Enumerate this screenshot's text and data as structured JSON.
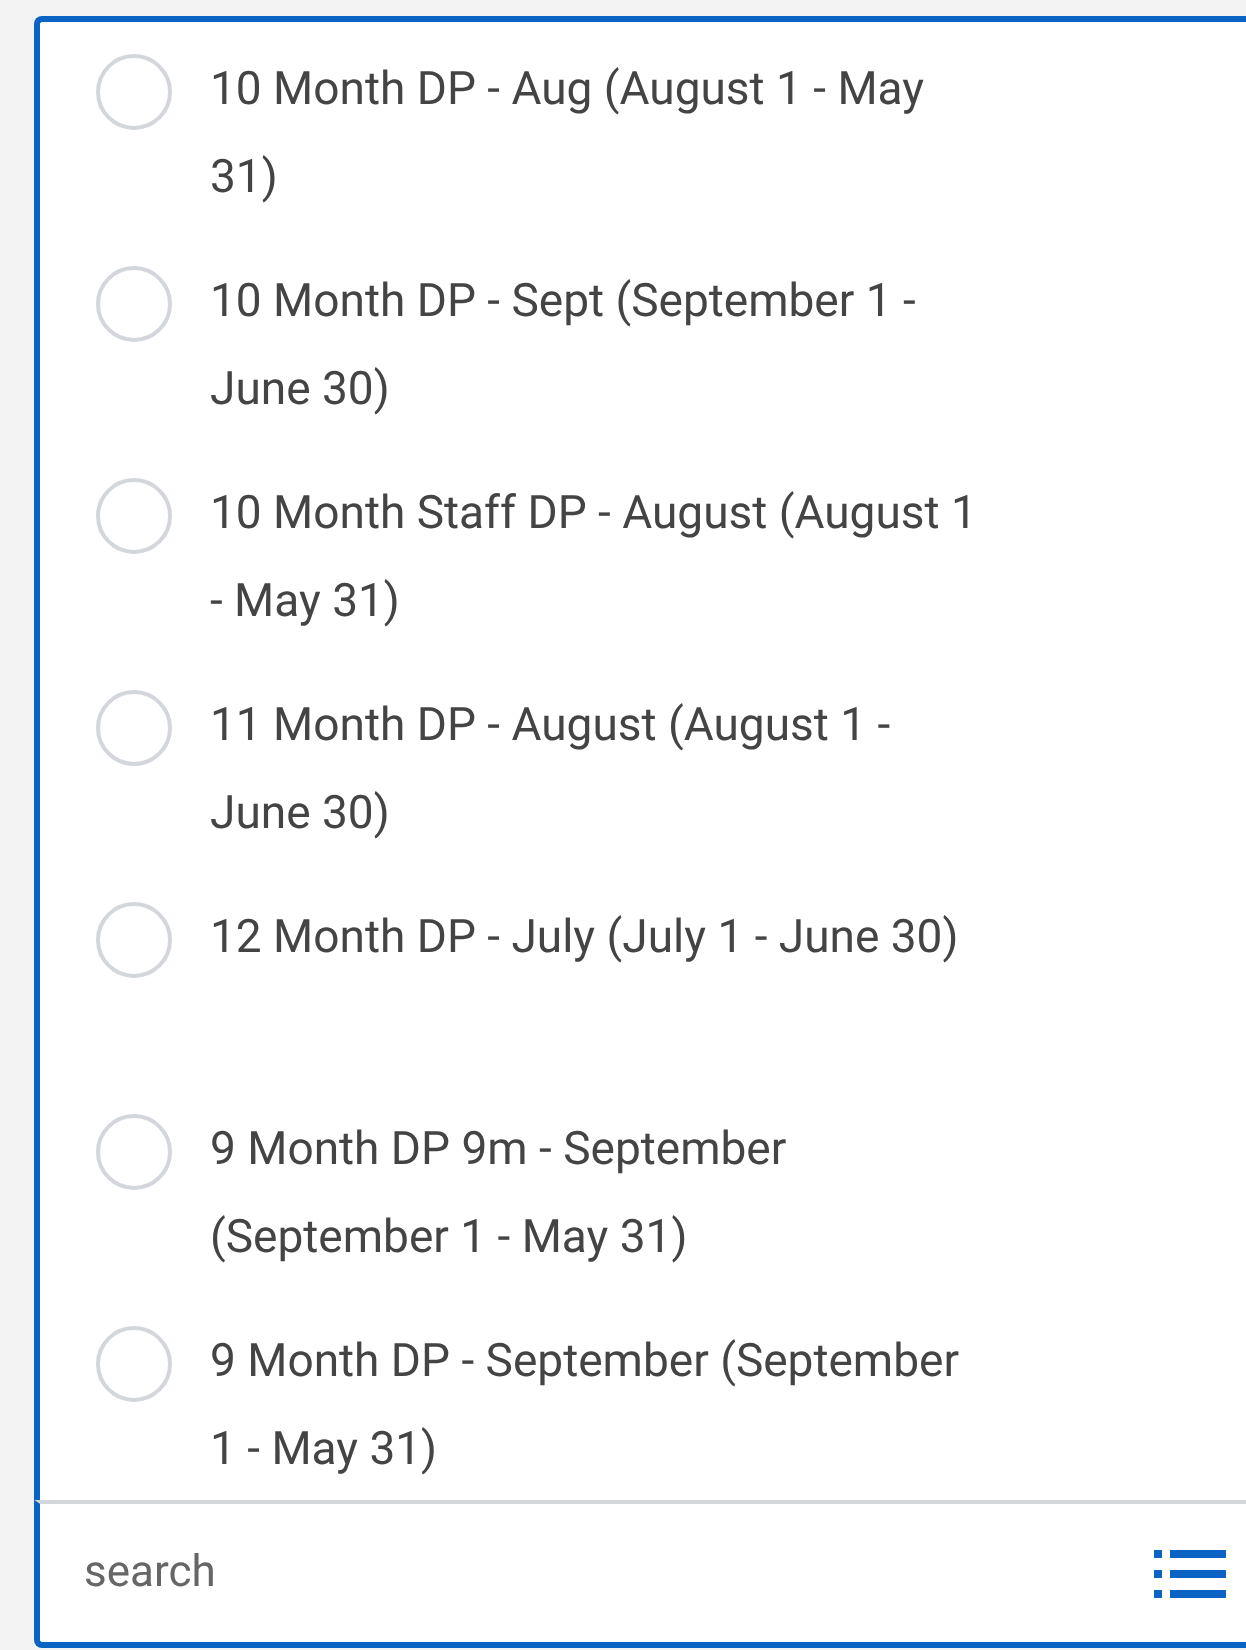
{
  "options": [
    {
      "label": "10 Month DP - Aug (August 1 - May 31)",
      "selected": false
    },
    {
      "label": "10 Month DP - Sept (September 1 - June 30)",
      "selected": false
    },
    {
      "label": "10 Month Staff DP - August (August 1 - May 31)",
      "selected": false
    },
    {
      "label": "11 Month DP - August (August 1 - June 30)",
      "selected": false
    },
    {
      "label": "12 Month DP - July (July 1 - June 30)",
      "selected": false
    },
    {
      "label": "9 Month DP 9m - September (September 1 - May 31)",
      "selected": false
    },
    {
      "label": "9 Month DP - September (September 1 - May 31)",
      "selected": false
    }
  ],
  "search": {
    "placeholder": "search"
  }
}
